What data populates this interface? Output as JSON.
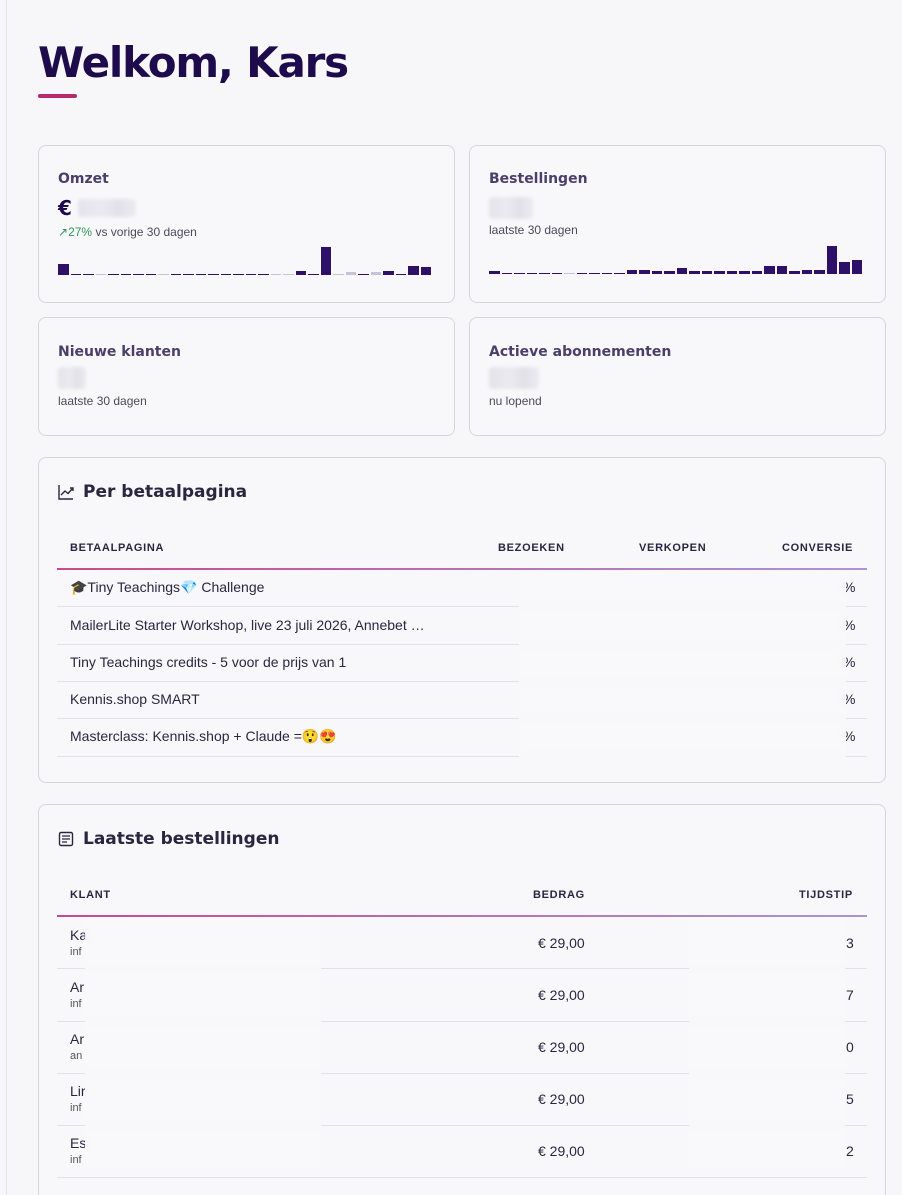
{
  "page": {
    "title": "Welkom, Kars"
  },
  "stats": {
    "omzet": {
      "label": "Omzet",
      "currency": "€",
      "trend_arrow": "↗",
      "trend_pct": "27%",
      "trend_text": "vs vorige 30 dagen",
      "bars": [
        0.38,
        0.05,
        0.05,
        0.05,
        0.05,
        0.05,
        0.05,
        0.05,
        0.05,
        0.05,
        0.05,
        0.05,
        0.05,
        0.05,
        0.05,
        0.05,
        0.05,
        0.05,
        0.05,
        0.15,
        0.05,
        1.0,
        0.05,
        0.1,
        0.05,
        0.1,
        0.15,
        0.05,
        0.32,
        0.3
      ],
      "bars_dim": [
        3,
        8,
        17,
        18,
        22,
        23,
        25
      ]
    },
    "bestellingen": {
      "label": "Bestellingen",
      "sub": "laatste 30 dagen",
      "bars": [
        0.1,
        0.05,
        0.05,
        0.05,
        0.05,
        0.05,
        0.05,
        0.05,
        0.05,
        0.05,
        0.05,
        0.16,
        0.16,
        0.12,
        0.12,
        0.2,
        0.1,
        0.1,
        0.1,
        0.1,
        0.1,
        0.1,
        0.3,
        0.28,
        0.12,
        0.14,
        0.14,
        1.0,
        0.42,
        0.5
      ],
      "bars_dim": [
        6
      ]
    },
    "nieuwe_klanten": {
      "label": "Nieuwe klanten",
      "sub": "laatste 30 dagen"
    },
    "actieve_abonnementen": {
      "label": "Actieve abonnementen",
      "sub": "nu lopend"
    }
  },
  "per_betaalpagina": {
    "title": "Per betaalpagina",
    "columns": [
      "BETAALPAGINA",
      "BEZOEKEN",
      "VERKOPEN",
      "CONVERSIE"
    ],
    "rows": [
      {
        "name": "🎓Tiny Teachings💎 Challenge",
        "pct": "%"
      },
      {
        "name": "MailerLite Starter Workshop, live 23 juli 2026, Annebet …",
        "pct": "%"
      },
      {
        "name": "Tiny Teachings credits - 5 voor de prijs van 1",
        "pct": "%"
      },
      {
        "name": "Kennis.shop SMART",
        "pct": "%"
      },
      {
        "name": "Masterclass: Kennis.shop + Claude =😲😍",
        "pct": "%"
      }
    ]
  },
  "laatste_bestellingen": {
    "title": "Laatste bestellingen",
    "columns": [
      "KLANT",
      "BEDRAG",
      "TIJDSTIP"
    ],
    "rows": [
      {
        "name": "Ka",
        "email": "inf",
        "amount": "€ 29,00",
        "time_end": "3"
      },
      {
        "name": "Ar",
        "email": "inf",
        "amount": "€ 29,00",
        "time_end": "7"
      },
      {
        "name": "Ar",
        "email": "an",
        "amount": "€ 29,00",
        "time_end": "0"
      },
      {
        "name": "Lir",
        "email": "inf",
        "amount": "€ 29,00",
        "time_end": "5"
      },
      {
        "name": "Es",
        "email": "inf",
        "amount": "€ 29,00",
        "time_end": "2"
      }
    ]
  },
  "colors": {
    "brand": "#1e0b4b",
    "accent": "#b8286f",
    "bar": "#2e1068",
    "trend": "#2f9456"
  }
}
